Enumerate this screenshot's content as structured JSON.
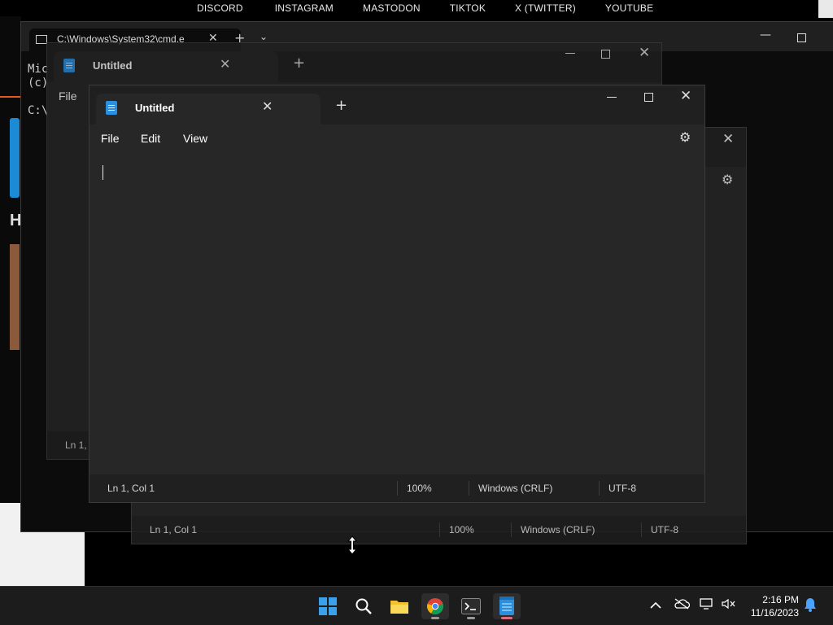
{
  "top_nav": {
    "links": [
      "DISCORD",
      "INSTAGRAM",
      "MASTODON",
      "TIKTOK",
      "X (TWITTER)",
      "YOUTUBE"
    ]
  },
  "cmd_window": {
    "tab_title": "C:\\Windows\\System32\\cmd.e",
    "console_lines": [
      "Mic",
      "(c)",
      "",
      "C:\\"
    ]
  },
  "notepad": {
    "tab_title": "Untitled",
    "menu": [
      "File",
      "Edit",
      "View"
    ],
    "status": {
      "position": "Ln 1, Col 1",
      "zoom": "100%",
      "line_ending": "Windows (CRLF)",
      "encoding": "UTF-8"
    },
    "back_menu_first": "File",
    "back_status_partial": "Ln 1, C"
  },
  "taskbar": {
    "time": "2:16 PM",
    "date": "11/16/2023"
  },
  "colors": {
    "notepad_bg": "#272727",
    "notepad_chrome": "#202020",
    "taskbar_bg": "#1c1c1c",
    "accent_pink": "#e06b7b"
  },
  "icons": [
    "windows-start-icon",
    "search-icon",
    "file-explorer-icon",
    "chrome-icon",
    "terminal-icon",
    "notepad-icon",
    "chevron-up-icon",
    "onedrive-icon",
    "network-icon",
    "volume-icon",
    "notification-bell-icon",
    "gear-icon"
  ]
}
